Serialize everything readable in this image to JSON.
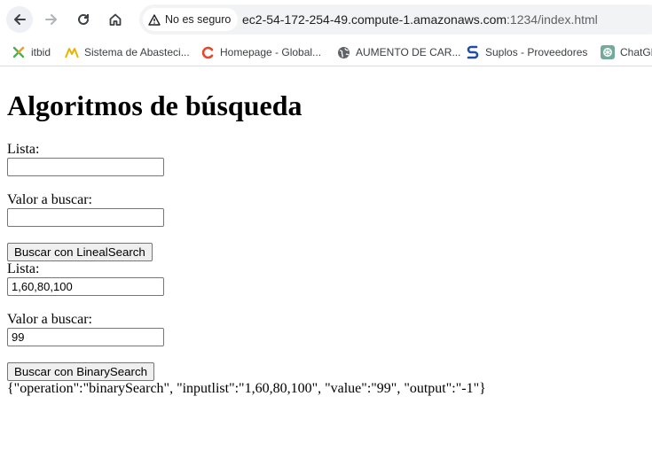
{
  "browser": {
    "security_label": "No es seguro",
    "url_host": "ec2-54-172-254-49.compute-1.amazonaws.com",
    "url_rest": ":1234/index.html",
    "bookmarks": [
      {
        "label": "itbid",
        "icon": "itbid-icon"
      },
      {
        "label": "Sistema de Abasteci...",
        "icon": "abastecimiento-icon"
      },
      {
        "label": "Homepage - Global...",
        "icon": "global-icon"
      },
      {
        "label": "AUMENTO DE CAR...",
        "icon": "globe-icon"
      },
      {
        "label": "Suplos - Proveedores",
        "icon": "suplos-icon"
      },
      {
        "label": "ChatGPT",
        "icon": "chatgpt-icon"
      }
    ]
  },
  "page": {
    "title": "Algoritmos de búsqueda",
    "linear": {
      "list_label": "Lista:",
      "list_value": "",
      "value_label": "Valor a buscar:",
      "value_value": "",
      "button": "Buscar con LinealSearch"
    },
    "binary": {
      "list_label": "Lista:",
      "list_value": "1,60,80,100",
      "value_label": "Valor a buscar:",
      "value_value": "99",
      "button": "Buscar con BinarySearch"
    },
    "output": "{\"operation\":\"binarySearch\", \"inputlist\":\"1,60,80,100\", \"value\":\"99\", \"output\":\"-1\"}"
  }
}
